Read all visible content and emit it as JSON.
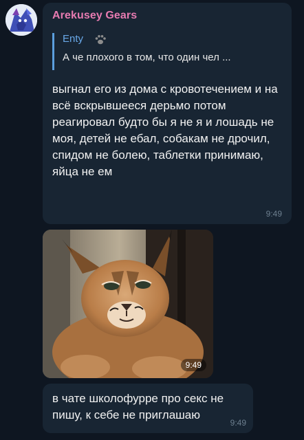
{
  "chat": {
    "sender_name": "Arekusey Gears",
    "reply": {
      "author": "Enty",
      "snippet": "А че плохого в том, что один чел ..."
    },
    "message1": {
      "text": "выгнал его из дома с кровотечением и на всё вскрывшееся дерьмо потом реагировал будто бы я не я и лошадь не моя, детей не ебал, собакам не дрочил, спидом не болею, таблетки принимаю, яйца не ем",
      "time": "9:49"
    },
    "photo": {
      "subject": "caracal-cat-photo",
      "time": "9:49"
    },
    "message3": {
      "text": "в чате школофурре про секс не пишу, к себе не приглашаю",
      "time": "9:49"
    }
  },
  "colors": {
    "background": "#0e1621",
    "bubble": "#182533",
    "sender_name": "#e77bb1",
    "reply_accent": "#5b9fde",
    "time": "#6d7f8f"
  }
}
